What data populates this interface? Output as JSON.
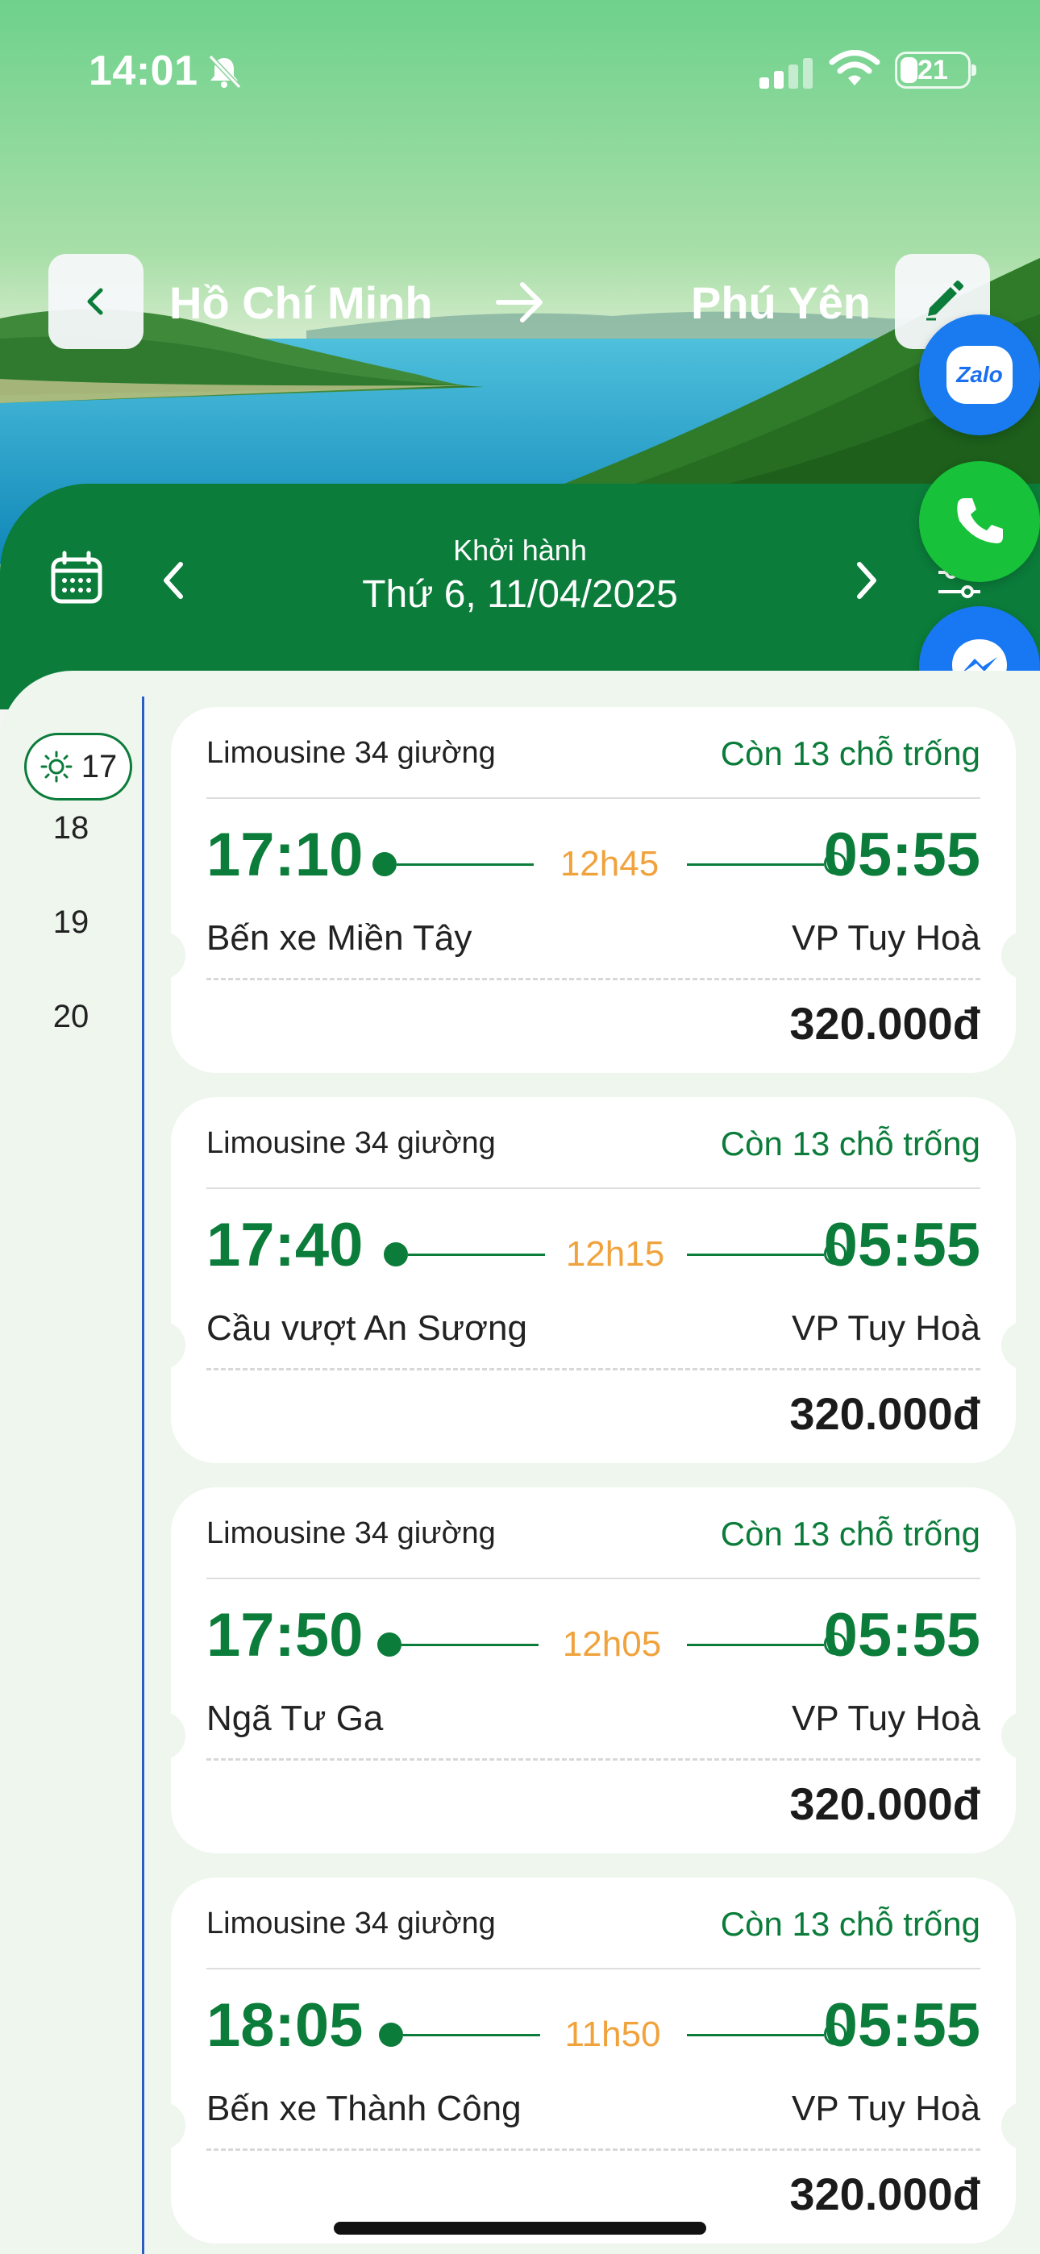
{
  "status_bar": {
    "time": "14:01",
    "battery": "21"
  },
  "route": {
    "from": "Hồ Chí Minh",
    "to": "Phú Yên"
  },
  "contact": {
    "zalo_label": "Zalo"
  },
  "date_bar": {
    "label": "Khởi hành",
    "date": "Thứ 6, 11/04/2025"
  },
  "hours": [
    "17",
    "18",
    "19",
    "20"
  ],
  "trips": [
    {
      "bus_type": "Limousine 34 giường",
      "seats": "Còn 13 chỗ trống",
      "depart": "17:10",
      "duration": "12h45",
      "arrive": "05:55",
      "from": "Bến xe Miền Tây",
      "to": "VP Tuy Hoà",
      "price": "320.000đ"
    },
    {
      "bus_type": "Limousine 34 giường",
      "seats": "Còn 13 chỗ trống",
      "depart": "17:40",
      "duration": "12h15",
      "arrive": "05:55",
      "from": "Cầu vượt An Sương",
      "to": "VP Tuy Hoà",
      "price": "320.000đ"
    },
    {
      "bus_type": "Limousine 34 giường",
      "seats": "Còn 13 chỗ trống",
      "depart": "17:50",
      "duration": "12h05",
      "arrive": "05:55",
      "from": "Ngã Tư Ga",
      "to": "VP Tuy Hoà",
      "price": "320.000đ"
    },
    {
      "bus_type": "Limousine 34 giường",
      "seats": "Còn 13 chỗ trống",
      "depart": "18:05",
      "duration": "11h50",
      "arrive": "05:55",
      "from": "Bến xe Thành Công",
      "to": "VP Tuy Hoà",
      "price": "320.000đ"
    }
  ],
  "colors": {
    "brand": "#0b7c3a",
    "duration": "#f0a23c",
    "zalo": "#1a7bf0",
    "phone": "#17c23a",
    "messenger": "#1877f2"
  }
}
